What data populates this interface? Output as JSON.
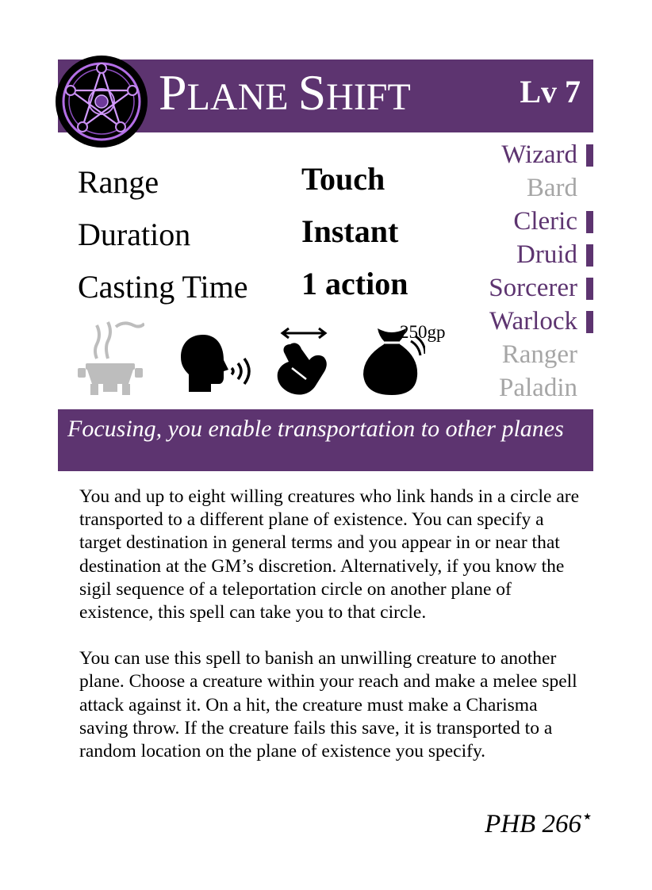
{
  "card": {
    "title": "Plane Shift",
    "title_first_letter": "P",
    "title_rest_1": "LANE",
    "title_second_letter": "S",
    "title_rest_2": "HIFT",
    "level": "Lv 7",
    "stats": [
      {
        "label": "Range",
        "value": "Touch"
      },
      {
        "label": "Duration",
        "value": "Instant"
      },
      {
        "label": "Casting Time",
        "value": "1 action"
      }
    ],
    "classes": [
      {
        "name": "Wizard",
        "available": true
      },
      {
        "name": "Bard",
        "available": false
      },
      {
        "name": "Cleric",
        "available": true
      },
      {
        "name": "Druid",
        "available": true
      },
      {
        "name": "Sorcerer",
        "available": true
      },
      {
        "name": "Warlock",
        "available": true
      },
      {
        "name": "Ranger",
        "available": false
      },
      {
        "name": "Paladin",
        "available": false
      }
    ],
    "components": {
      "ritual": false,
      "verbal": true,
      "somatic": true,
      "material": true,
      "material_cost": "250gp"
    },
    "tagline": "Focusing, you enable transportation to other planes",
    "description": [
      "You and up to eight willing creatures who link hands in a circle are transported to a different plane of existence. You can specify a target destination in general terms and you appear in or near that destination at the GM’s discretion. Alternatively, if you know the sigil sequence of a teleportation circle on another plane of existence, this spell can take you to that circle.",
      "You can use this spell to banish an unwilling creature to another plane. Choose a creature within your reach and make a melee spell attack against it. On a hit, the creature must make a Charisma saving throw. If the creature fails this save, it is transported to a random location on the plane of existence you specify."
    ],
    "source": "PHB 266",
    "source_mark": "⋆",
    "colors": {
      "accent": "#5d3470",
      "inactive": "#a6a6a6",
      "emblem_glow": "#b36ee6"
    }
  }
}
